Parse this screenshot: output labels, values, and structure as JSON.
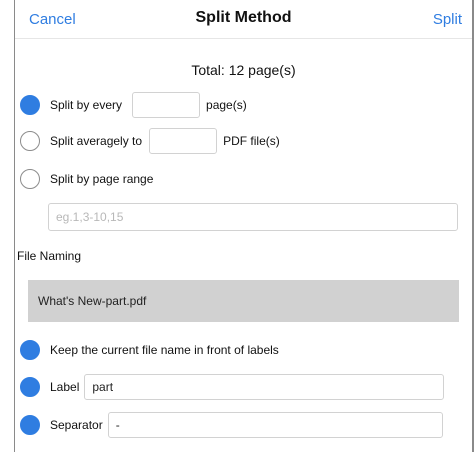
{
  "nav": {
    "cancel_label": "Cancel",
    "title": "Split Method",
    "split_label": "Split"
  },
  "total_text": "Total: 12 page(s)",
  "options": {
    "every": {
      "label": "Split by every",
      "value": "",
      "suffix": "page(s)",
      "selected": true
    },
    "average": {
      "label": "Split averagely to",
      "value": "",
      "suffix": "PDF file(s)",
      "selected": false
    },
    "range": {
      "label": "Split by page range",
      "value": "",
      "placeholder": "eg.1,3-10,15",
      "selected": false
    }
  },
  "file_naming": {
    "heading": "File Naming",
    "preview": "What's New-part.pdf",
    "keep_name_label": "Keep the current file name in front of labels",
    "keep_name_selected": true,
    "label_label": "Label",
    "label_value": "part",
    "label_selected": true,
    "separator_label": "Separator",
    "separator_value": "-",
    "separator_selected": true
  },
  "colors": {
    "accent": "#2f7de1",
    "preview_bg": "#d1d1d1"
  }
}
